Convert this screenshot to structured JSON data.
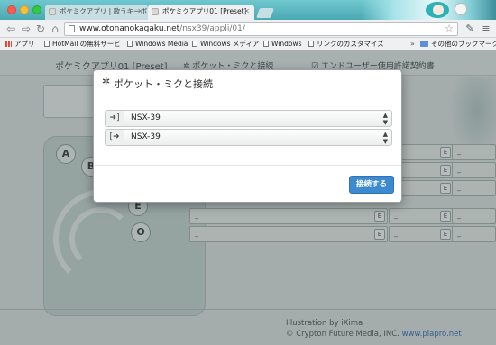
{
  "browser": {
    "tabs": [
      {
        "label": "ポケミクアプリ | 歌うキーボ"
      },
      {
        "label": "ポケミクアプリ01 [Preset]"
      }
    ],
    "url": {
      "host": "www.otonanokagaku.net",
      "path": "/nsx39/appli/01/"
    },
    "bookmarks": [
      {
        "label": "アプリ"
      },
      {
        "label": "HotMail の無料サービ"
      },
      {
        "label": "Windows Media"
      },
      {
        "label": "Windows メディア"
      },
      {
        "label": "Windows"
      },
      {
        "label": "リンクのカスタマイズ"
      },
      {
        "label": "その他のブックマーク"
      }
    ],
    "bookmarks_overflow": "»"
  },
  "page": {
    "app_title": "ポケミクアプリ01 [Preset]",
    "header_links": [
      {
        "label": "ポケット・ミクと接続"
      },
      {
        "label": "エンドユーザー使用許諾契約書"
      }
    ],
    "buttons": {
      "a": "A",
      "b": "B",
      "e": "E",
      "o": "O"
    },
    "row_placeholder": "_",
    "e_label": "E",
    "credit_line1": "Illustration by iXima",
    "credit_line2_prefix": "© Crypton Future Media, INC.",
    "credit_link": "www.piapro.net"
  },
  "modal": {
    "title": "ポケット・ミクと接続",
    "input_port": {
      "value": "NSX-39"
    },
    "output_port": {
      "value": "NSX-39"
    },
    "connect_button": "接続する"
  },
  "colors": {
    "accent": "#3d8ad0",
    "tabstrip": "#4aa9b4",
    "link": "#3c74b8"
  }
}
